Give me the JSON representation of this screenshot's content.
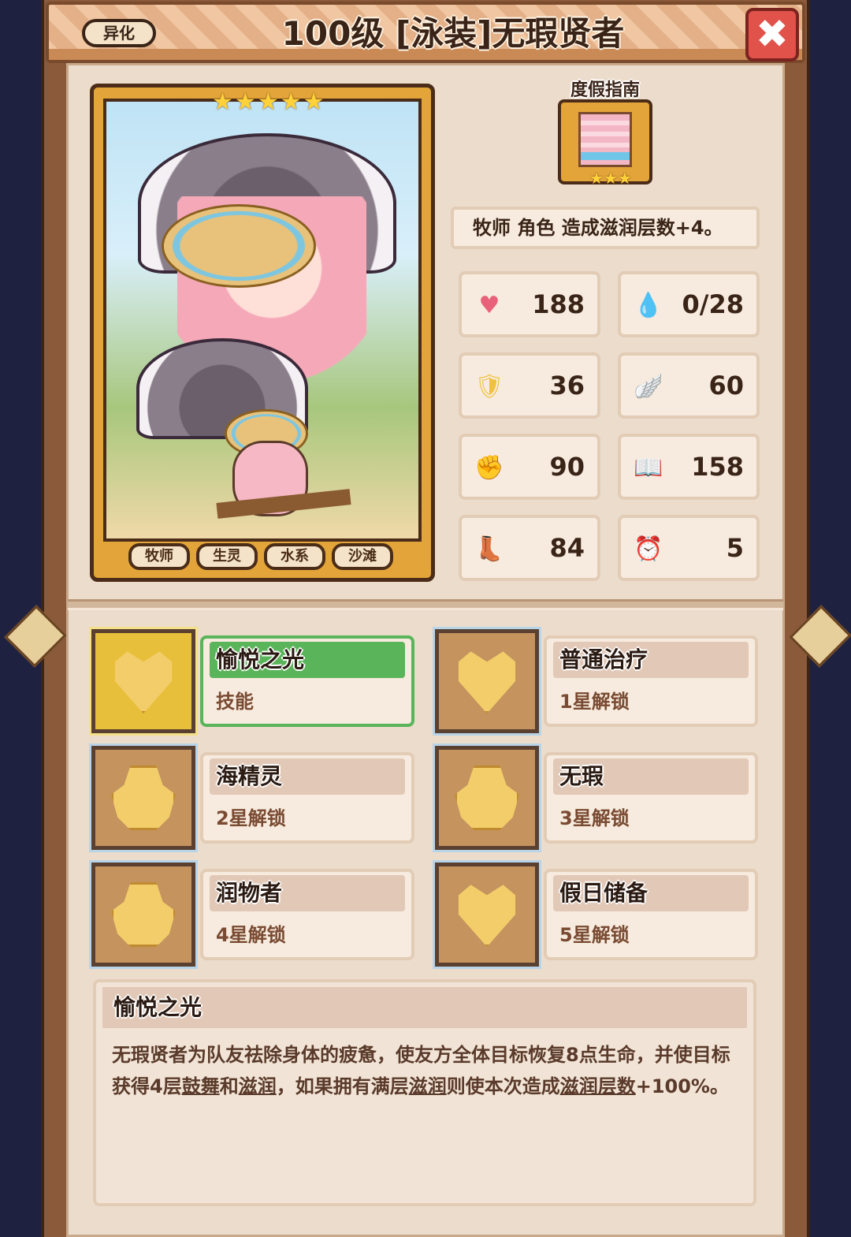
{
  "header": {
    "variant_label": "异化",
    "title": "100级 [泳装]无瑕贤者",
    "close_symbol": "✖"
  },
  "character": {
    "stars": 5,
    "tags": [
      "牧师",
      "生灵",
      "水系",
      "沙滩"
    ]
  },
  "equipment": {
    "name": "度假指南",
    "stars": 3,
    "description": "牧师 角色 造成滋润层数+4。"
  },
  "stats": [
    {
      "icon": "heart-icon",
      "glyph": "♥",
      "color": "#e8607a",
      "value": "188"
    },
    {
      "icon": "mana-drop-icon",
      "glyph": "💧",
      "color": "#5ab8e8",
      "value": "0/28"
    },
    {
      "icon": "shield-icon",
      "glyph": "🛡",
      "color": "#f0c040",
      "value": "36"
    },
    {
      "icon": "wing-icon",
      "glyph": "🪽",
      "color": "#c8d8e8",
      "value": "60"
    },
    {
      "icon": "fist-icon",
      "glyph": "✊",
      "color": "#f0b8a0",
      "value": "90"
    },
    {
      "icon": "spellbook-icon",
      "glyph": "📖",
      "color": "#c83a3a",
      "value": "158"
    },
    {
      "icon": "boot-icon",
      "glyph": "👢",
      "color": "#3a6ab8",
      "value": "84"
    },
    {
      "icon": "clock-icon",
      "glyph": "⏰",
      "color": "#f0c040",
      "value": "5"
    }
  ],
  "skills": [
    {
      "name": "愉悦之光",
      "sub": "技能",
      "selected": true,
      "shape": "heart"
    },
    {
      "name": "普通治疗",
      "sub": "1星解锁",
      "selected": false,
      "shape": "heart"
    },
    {
      "name": "海精灵",
      "sub": "2星解锁",
      "selected": false,
      "shape": "blob"
    },
    {
      "name": "无瑕",
      "sub": "3星解锁",
      "selected": false,
      "shape": "blob"
    },
    {
      "name": "润物者",
      "sub": "4星解锁",
      "selected": false,
      "shape": "blob"
    },
    {
      "name": "假日储备",
      "sub": "5星解锁",
      "selected": false,
      "shape": "heart"
    }
  ],
  "description": {
    "title": "愉悦之光",
    "parts": [
      {
        "text": "无瑕贤者为队友祛除身体的疲惫，使友方全体目标恢复8点生命，并使目标获得4层",
        "kw": false
      },
      {
        "text": "鼓舞",
        "kw": true
      },
      {
        "text": "和",
        "kw": false
      },
      {
        "text": "滋润",
        "kw": true
      },
      {
        "text": "，如果拥有满层",
        "kw": false
      },
      {
        "text": "滋润",
        "kw": true
      },
      {
        "text": "则使本次造成",
        "kw": false
      },
      {
        "text": "滋润层数",
        "kw": true
      },
      {
        "text": "+100%。",
        "kw": false
      }
    ]
  }
}
